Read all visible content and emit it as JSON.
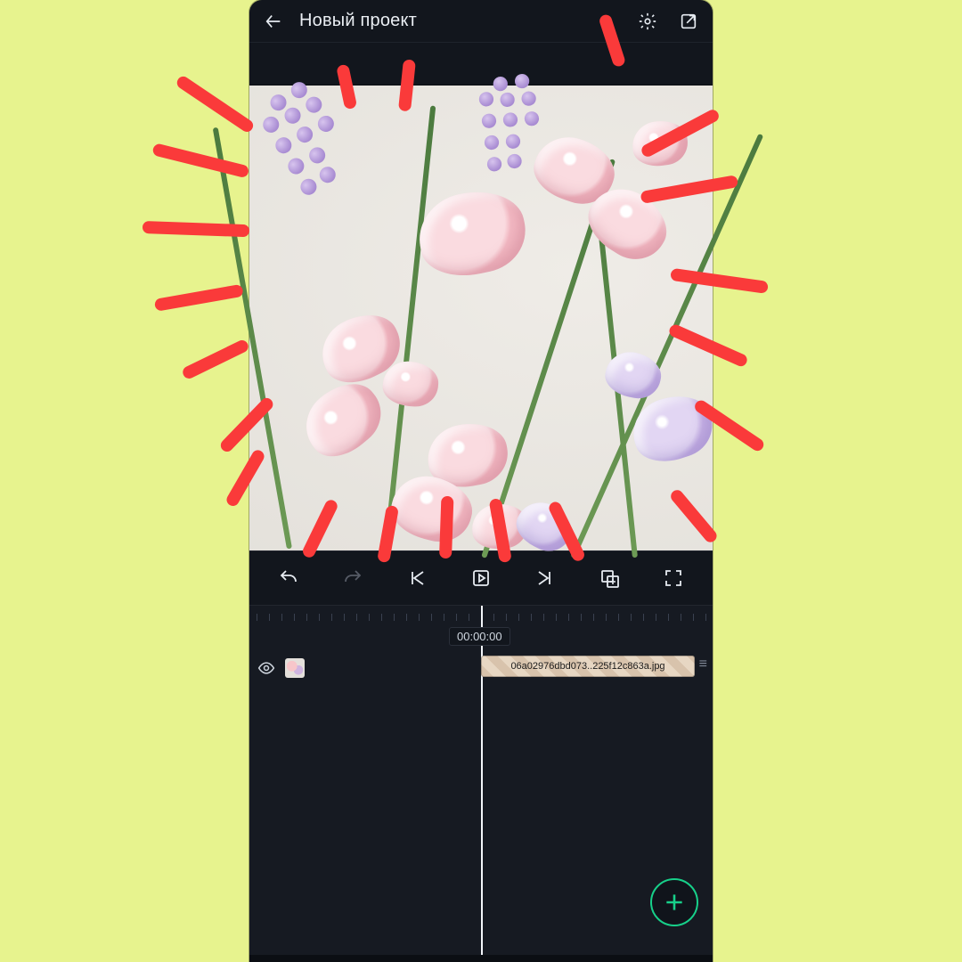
{
  "header": {
    "title": "Новый проект"
  },
  "timeline": {
    "timecode": "00:00:00",
    "clip_label": "06a02976dbd073..225f12c863a.jpg"
  },
  "icons": {
    "back": "back-icon",
    "settings": "gear-icon",
    "export": "external-link-icon",
    "undo": "undo-icon",
    "redo": "redo-icon",
    "to_start": "skip-start-icon",
    "play": "play-icon",
    "to_end": "skip-end-icon",
    "add_frame": "add-frame-icon",
    "fullscreen": "fullscreen-icon",
    "visibility": "eye-icon",
    "add": "plus-icon",
    "more": "more-icon"
  },
  "colors": {
    "bg": "#e7f38e",
    "app_bg": "#12161d",
    "accent": "#17d08a",
    "ray": "#fa3a3a"
  }
}
